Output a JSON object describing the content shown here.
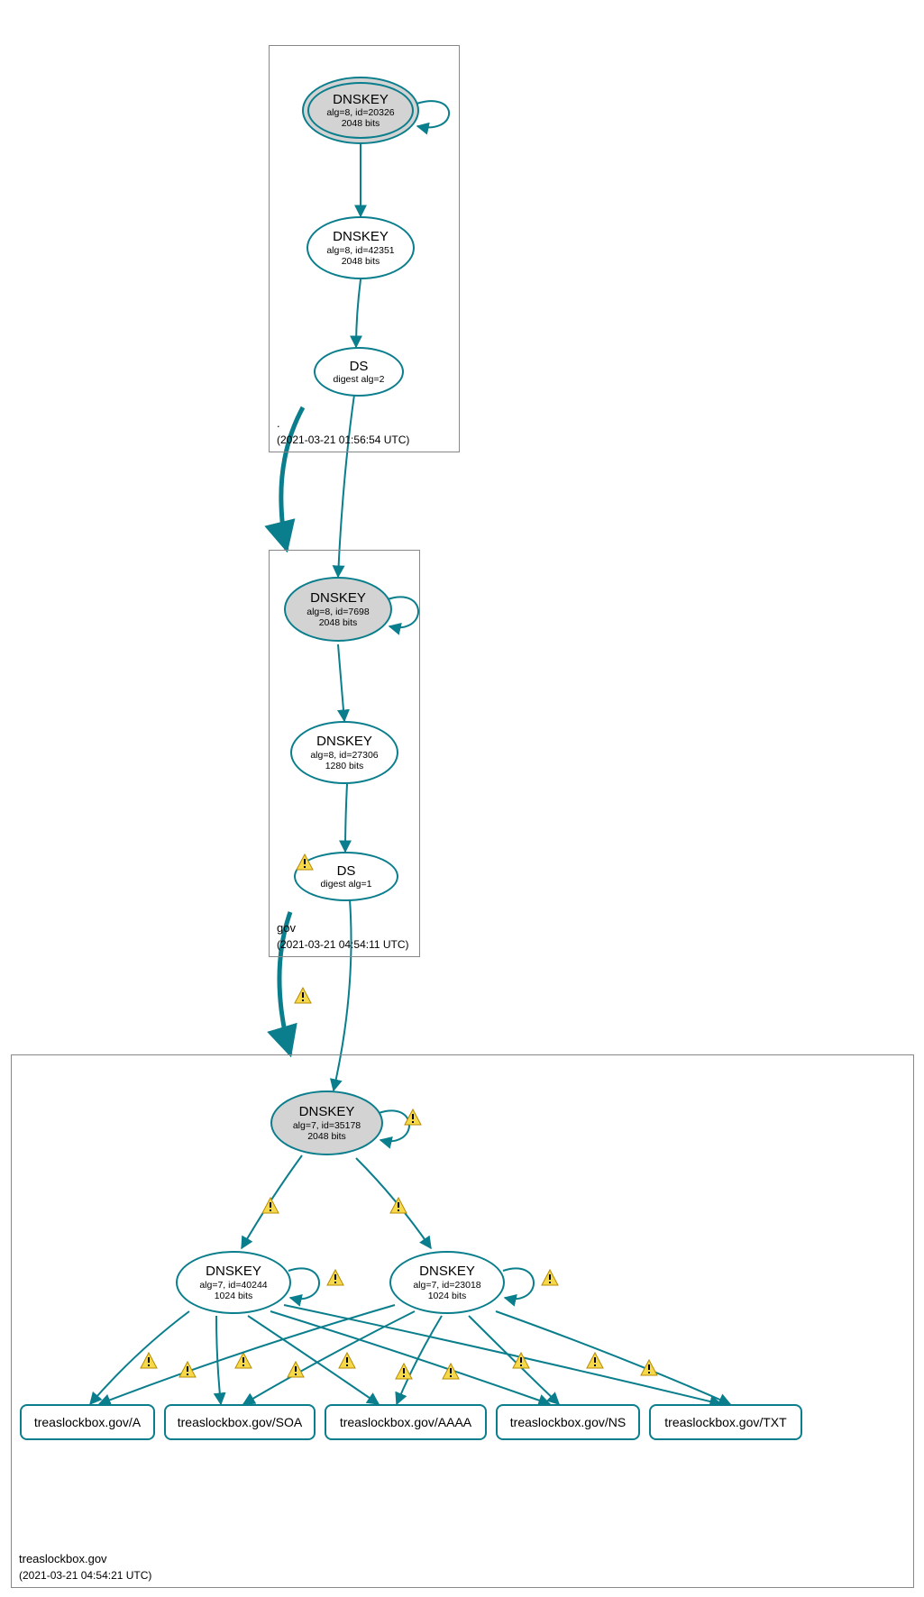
{
  "colors": {
    "edge": "#0a7e8c",
    "fillKSK": "#d3d3d3",
    "warnFill": "#f6d94a",
    "warnStroke": "#b78b00"
  },
  "zones": {
    "root": {
      "label": ".",
      "timestamp": "(2021-03-21 01:56:54 UTC)"
    },
    "gov": {
      "label": "gov",
      "timestamp": "(2021-03-21 04:54:11 UTC)"
    },
    "leaf": {
      "label": "treaslockbox.gov",
      "timestamp": "(2021-03-21 04:54:21 UTC)"
    }
  },
  "nodes": {
    "rootKSK": {
      "title": "DNSKEY",
      "line1": "alg=8, id=20326",
      "line2": "2048 bits"
    },
    "rootZSK": {
      "title": "DNSKEY",
      "line1": "alg=8, id=42351",
      "line2": "2048 bits"
    },
    "rootDS": {
      "title": "DS",
      "line1": "digest alg=2",
      "line2": ""
    },
    "govKSK": {
      "title": "DNSKEY",
      "line1": "alg=8, id=7698",
      "line2": "2048 bits"
    },
    "govZSK": {
      "title": "DNSKEY",
      "line1": "alg=8, id=27306",
      "line2": "1280 bits"
    },
    "govDS": {
      "title": "DS",
      "line1": "digest alg=1",
      "line2": ""
    },
    "leafKSK": {
      "title": "DNSKEY",
      "line1": "alg=7, id=35178",
      "line2": "2048 bits"
    },
    "leafZSK1": {
      "title": "DNSKEY",
      "line1": "alg=7, id=40244",
      "line2": "1024 bits"
    },
    "leafZSK2": {
      "title": "DNSKEY",
      "line1": "alg=7, id=23018",
      "line2": "1024 bits"
    }
  },
  "rrsets": {
    "a": "treaslockbox.gov/A",
    "soa": "treaslockbox.gov/SOA",
    "aaaa": "treaslockbox.gov/AAAA",
    "ns": "treaslockbox.gov/NS",
    "txt": "treaslockbox.gov/TXT"
  }
}
